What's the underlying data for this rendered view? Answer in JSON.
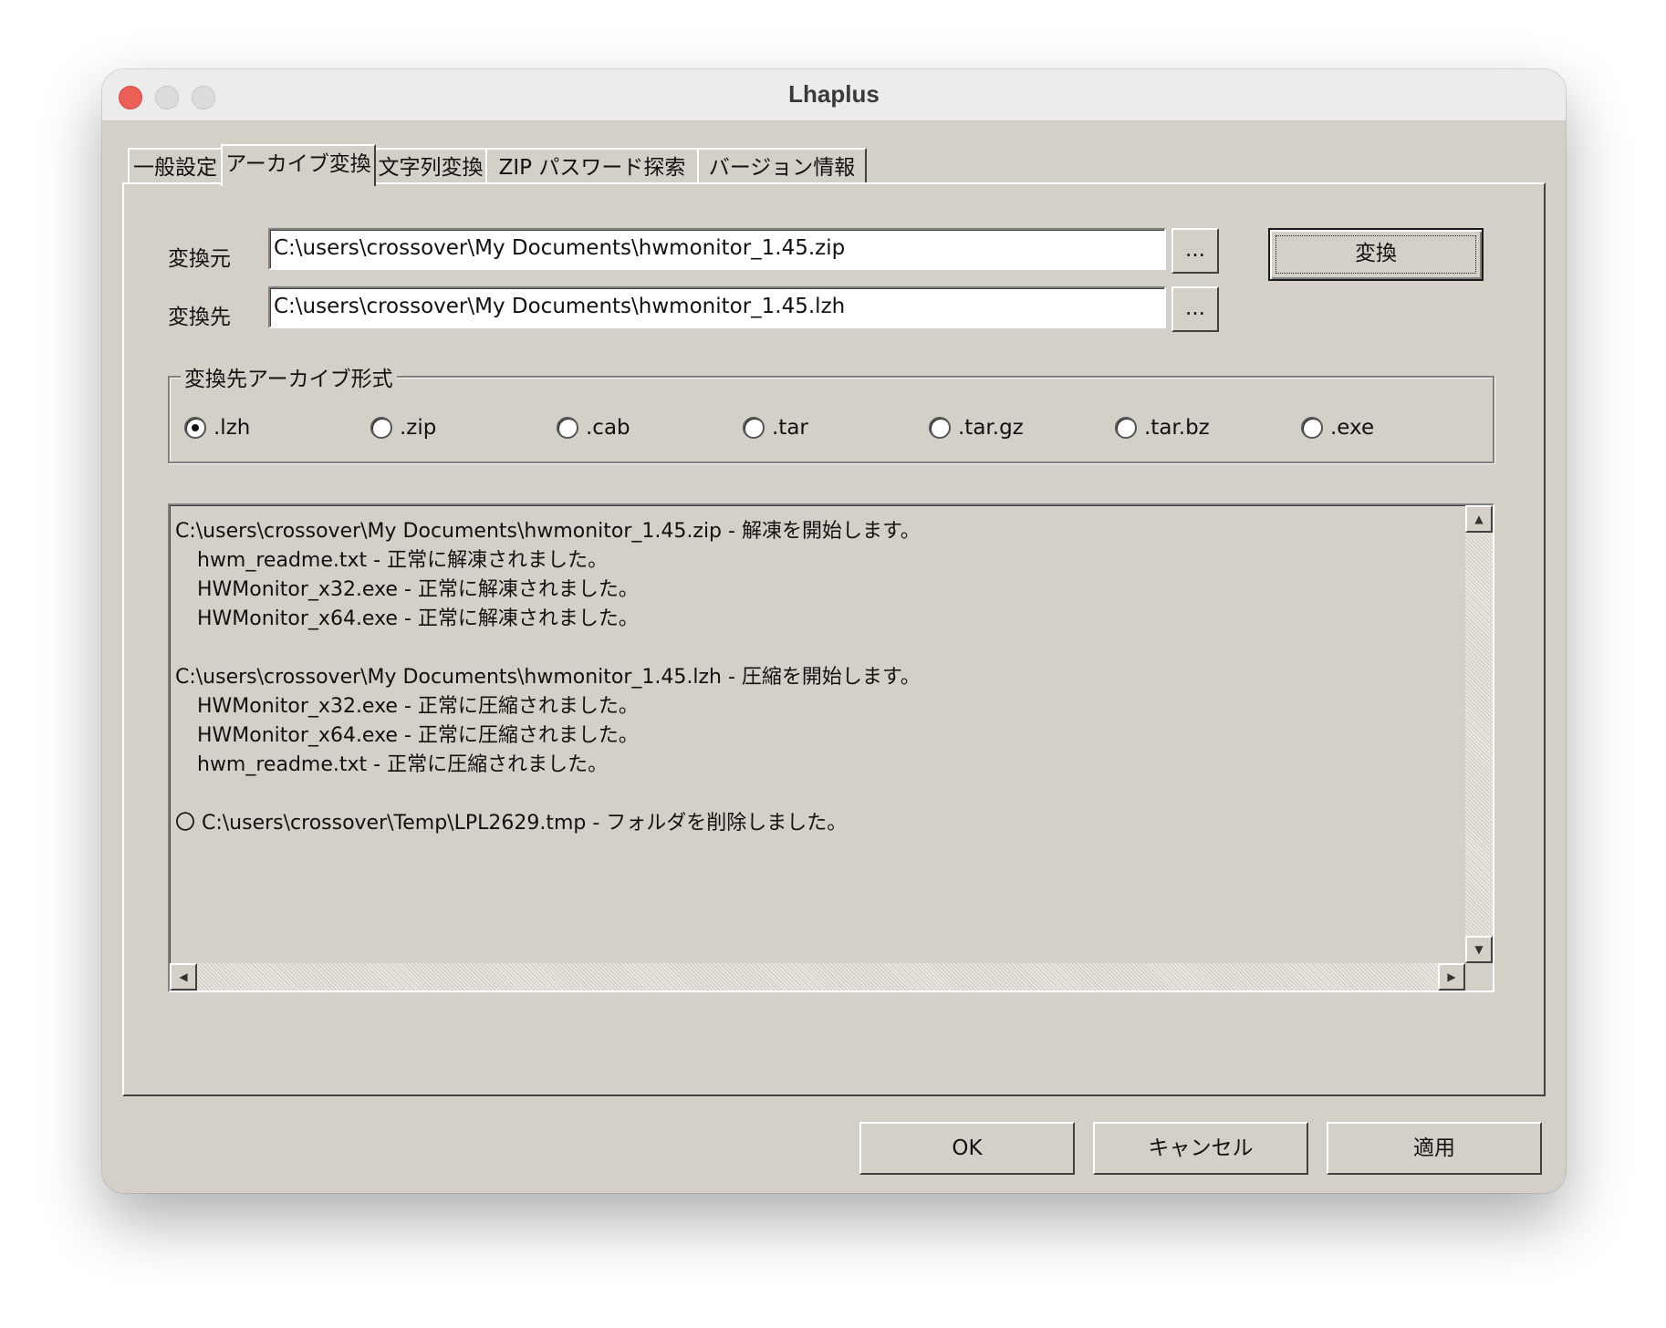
{
  "window": {
    "title": "Lhaplus"
  },
  "tabs": [
    {
      "label": "一般設定",
      "active": false
    },
    {
      "label": "アーカイブ変換",
      "active": true
    },
    {
      "label": "文字列変換",
      "active": false
    },
    {
      "label": "ZIP パスワード探索",
      "active": false
    },
    {
      "label": "バージョン情報",
      "active": false
    }
  ],
  "conversion": {
    "source_label": "変換元",
    "source_value": "C:\\users\\crossover\\My Documents\\hwmonitor_1.45.zip",
    "dest_label": "変換先",
    "dest_value": "C:\\users\\crossover\\My Documents\\hwmonitor_1.45.lzh",
    "browse_label": "...",
    "convert_button": "変換"
  },
  "format_group": {
    "title": "変換先アーカイブ形式",
    "options": [
      ".lzh",
      ".zip",
      ".cab",
      ".tar",
      ".tar.gz",
      ".tar.bz",
      ".exe"
    ],
    "selected": ".lzh"
  },
  "log": {
    "lines": [
      "C:\\users\\crossover\\My Documents\\hwmonitor_1.45.zip - 解凍を開始します。",
      "hwm_readme.txt - 正常に解凍されました。",
      "HWMonitor_x32.exe - 正常に解凍されました。",
      "HWMonitor_x64.exe - 正常に解凍されました。",
      "C:\\users\\crossover\\My Documents\\hwmonitor_1.45.lzh - 圧縮を開始します。",
      "HWMonitor_x32.exe - 正常に圧縮されました。",
      "HWMonitor_x64.exe - 正常に圧縮されました。",
      "hwm_readme.txt - 正常に圧縮されました。",
      "〇 C:\\users\\crossover\\Temp\\LPL2629.tmp - フォルダを削除しました。"
    ]
  },
  "footer": {
    "ok": "OK",
    "cancel": "キャンセル",
    "apply": "適用"
  },
  "colors": {
    "dialog_bg": "#d4d0c8",
    "close_button": "#ec5f57"
  }
}
